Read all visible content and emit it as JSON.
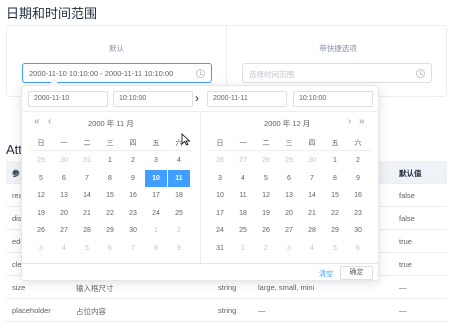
{
  "page_title": "日期和时间范围",
  "demo": {
    "left_label": "默认",
    "left_value": "2000-11-10 10:10:00 - 2000-11-11 10:10:00",
    "right_label": "带快捷选项",
    "right_placeholder": "选择时间范围"
  },
  "attributes_heading": "Att",
  "table": {
    "headers": [
      "参",
      "",
      "",
      "",
      "默认值"
    ],
    "rows": [
      {
        "c1": "rea",
        "c2": "",
        "c3": "",
        "c4": "",
        "c5": "false"
      },
      {
        "c1": "dis",
        "c2": "",
        "c3": "",
        "c4": "",
        "c5": "false"
      },
      {
        "c1": "edi",
        "c2": "",
        "c3": "",
        "c4": "",
        "c5": "true"
      },
      {
        "c1": "cle",
        "c2": "",
        "c3": "",
        "c4": "",
        "c5": "true"
      },
      {
        "c1": "size",
        "c2": "输入框尺寸",
        "c3": "string",
        "c4": "large, small, mini",
        "c5": "—"
      },
      {
        "c1": "placeholder",
        "c2": "占位内容",
        "c3": "string",
        "c4": "—",
        "c5": "—"
      }
    ]
  },
  "picker": {
    "start_date": "2000-11-10",
    "start_time": "10:10:00",
    "end_date": "2000-11-11",
    "end_time": "10:10:00",
    "left_month": "2000 年 11 月",
    "right_month": "2000 年 12 月",
    "weekdays": [
      "日",
      "一",
      "二",
      "三",
      "四",
      "五",
      "六"
    ],
    "left_days": [
      [
        "29",
        "30",
        "31",
        "1",
        "2",
        "3",
        "4"
      ],
      [
        "5",
        "6",
        "7",
        "8",
        "9",
        "10",
        "11"
      ],
      [
        "12",
        "13",
        "14",
        "15",
        "16",
        "17",
        "18"
      ],
      [
        "19",
        "20",
        "21",
        "22",
        "23",
        "24",
        "25"
      ],
      [
        "26",
        "27",
        "28",
        "29",
        "30",
        "1",
        "2"
      ],
      [
        "3",
        "4",
        "5",
        "6",
        "7",
        "8",
        "9"
      ]
    ],
    "right_days": [
      [
        "26",
        "27",
        "28",
        "29",
        "30",
        "1",
        "2"
      ],
      [
        "3",
        "4",
        "5",
        "6",
        "7",
        "8",
        "9"
      ],
      [
        "10",
        "11",
        "12",
        "13",
        "14",
        "15",
        "16"
      ],
      [
        "17",
        "18",
        "19",
        "20",
        "21",
        "22",
        "23"
      ],
      [
        "24",
        "25",
        "26",
        "27",
        "28",
        "29",
        "30"
      ],
      [
        "31",
        "1",
        "2",
        "3",
        "4",
        "5",
        "6"
      ]
    ],
    "clear_label": "清空",
    "ok_label": "确定",
    "icons": {
      "prev_year": "double-chevron-left-icon",
      "prev_month": "chevron-left-icon",
      "next_month": "chevron-right-icon",
      "next_year": "double-chevron-right-icon",
      "range_separator": "chevron-right-icon",
      "input_icon": "clock-icon"
    },
    "accent_color": "#409eff"
  }
}
